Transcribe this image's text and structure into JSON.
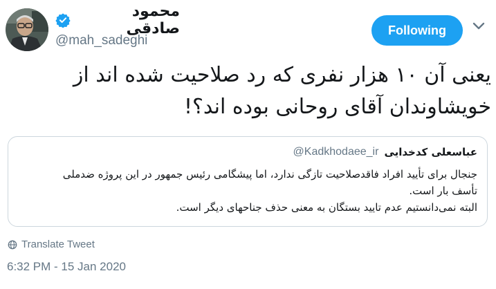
{
  "author": {
    "display_name": "محمود صادقی",
    "handle": "@mah_sadeghi",
    "verified": true,
    "avatar_icon": "profile-photo"
  },
  "follow_button": {
    "label": "Following",
    "color": "#1da1f2"
  },
  "menu": {
    "icon": "chevron-down-icon"
  },
  "tweet": {
    "lines": [
      "یعنی آن ۱۰ هزار نفری که رد صلاحیت شده اند از",
      "خویشاوندان آقای روحانی بوده اند؟!"
    ]
  },
  "quoted_tweet": {
    "display_name": "عباسعلی کدخدایی",
    "handle": "@Kadkhodaee_ir",
    "lines": [
      "جنجال برای تأیید افراد فاقدصلاحیت تازگی ندارد، اما پیشگامی رئیس جمهور در این پروژه ضدملی",
      "تأسف بار است.",
      "البته نمی‌دانستیم عدم تایید بستگان به معنی حذف جناحهای دیگر است."
    ]
  },
  "translate": {
    "label": "Translate Tweet",
    "icon": "globe-icon"
  },
  "timestamp": "6:32 PM - 15 Jan 2020",
  "colors": {
    "accent": "#1da1f2",
    "secondary_text": "#657786",
    "border": "#ccd6dd"
  }
}
